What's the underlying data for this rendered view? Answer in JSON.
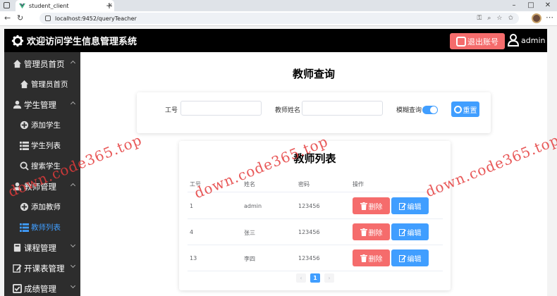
{
  "browser": {
    "tab_title": "student_client",
    "url": "localhost:9452/queryTeacher"
  },
  "header": {
    "app_title": "欢迎访问学生信息管理系统",
    "logout_label": "退出账号",
    "username": "admin"
  },
  "sidebar": {
    "groups": [
      {
        "label": "管理员首页",
        "items": [
          {
            "label": "管理员首页"
          }
        ]
      },
      {
        "label": "学生管理",
        "items": [
          {
            "label": "添加学生"
          },
          {
            "label": "学生列表"
          },
          {
            "label": "搜索学生"
          }
        ]
      },
      {
        "label": "教师管理",
        "items": [
          {
            "label": "添加教师"
          },
          {
            "label": "教师列表"
          }
        ]
      },
      {
        "label": "课程管理"
      },
      {
        "label": "开课表管理"
      },
      {
        "label": "成绩管理"
      }
    ]
  },
  "main": {
    "page_title": "教师查询",
    "search": {
      "id_label": "工号",
      "id_value": "",
      "name_label": "教师姓名",
      "name_value": "",
      "fuzzy_label": "模糊查询",
      "fuzzy_on": true,
      "reset_label": "重置"
    },
    "list": {
      "title": "教师列表",
      "columns": [
        "工号",
        "姓名",
        "密码",
        "操作"
      ],
      "rows": [
        {
          "id": "1",
          "name": "admin",
          "password": "123456"
        },
        {
          "id": "4",
          "name": "张三",
          "password": "123456"
        },
        {
          "id": "13",
          "name": "李四",
          "password": "123456"
        }
      ],
      "delete_label": "删除",
      "edit_label": "编辑",
      "current_page": "1"
    }
  },
  "watermark": "down.code365.top",
  "colors": {
    "primary": "#409eff",
    "danger": "#f56c6c",
    "header_bg": "#000000",
    "sidebar_bg": "#2d2d2d",
    "watermark": "#e43b3b"
  }
}
